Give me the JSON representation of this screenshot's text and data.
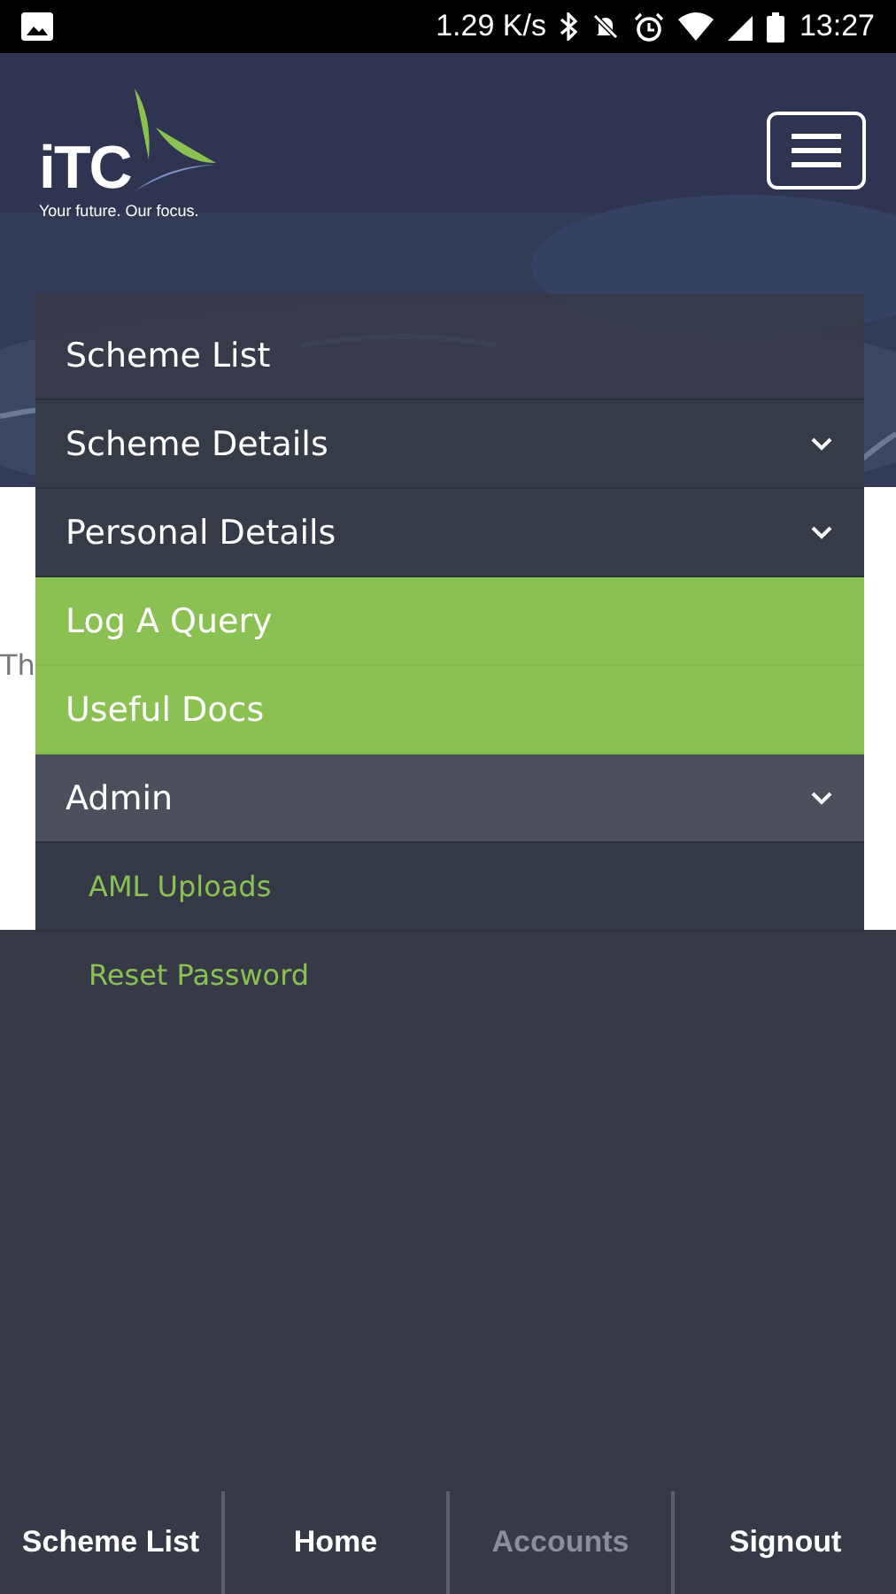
{
  "status_bar": {
    "speed": "1.29 K/s",
    "time": "13:27"
  },
  "header": {
    "logo": "iTC",
    "tagline": "Your future. Our focus."
  },
  "content": {
    "text": "Th"
  },
  "menu": [
    {
      "label": "Scheme List",
      "kind": "link",
      "highlighted": false,
      "expanded": false
    },
    {
      "label": "Scheme Details",
      "kind": "dropdown",
      "highlighted": false,
      "expanded": false
    },
    {
      "label": "Personal Details",
      "kind": "dropdown",
      "highlighted": false,
      "expanded": false
    },
    {
      "label": "Log A Query",
      "kind": "link",
      "highlighted": true,
      "expanded": false
    },
    {
      "label": "Useful Docs",
      "kind": "link",
      "highlighted": true,
      "expanded": false
    },
    {
      "label": "Admin",
      "kind": "dropdown",
      "highlighted": false,
      "expanded": true,
      "children": [
        {
          "label": "AML Uploads"
        },
        {
          "label": "Reset Password"
        }
      ]
    }
  ],
  "bottom_nav": [
    {
      "label": "Scheme List",
      "selected": false
    },
    {
      "label": "Home",
      "selected": false
    },
    {
      "label": "Accounts",
      "selected": true
    },
    {
      "label": "Signout",
      "selected": false
    }
  ]
}
